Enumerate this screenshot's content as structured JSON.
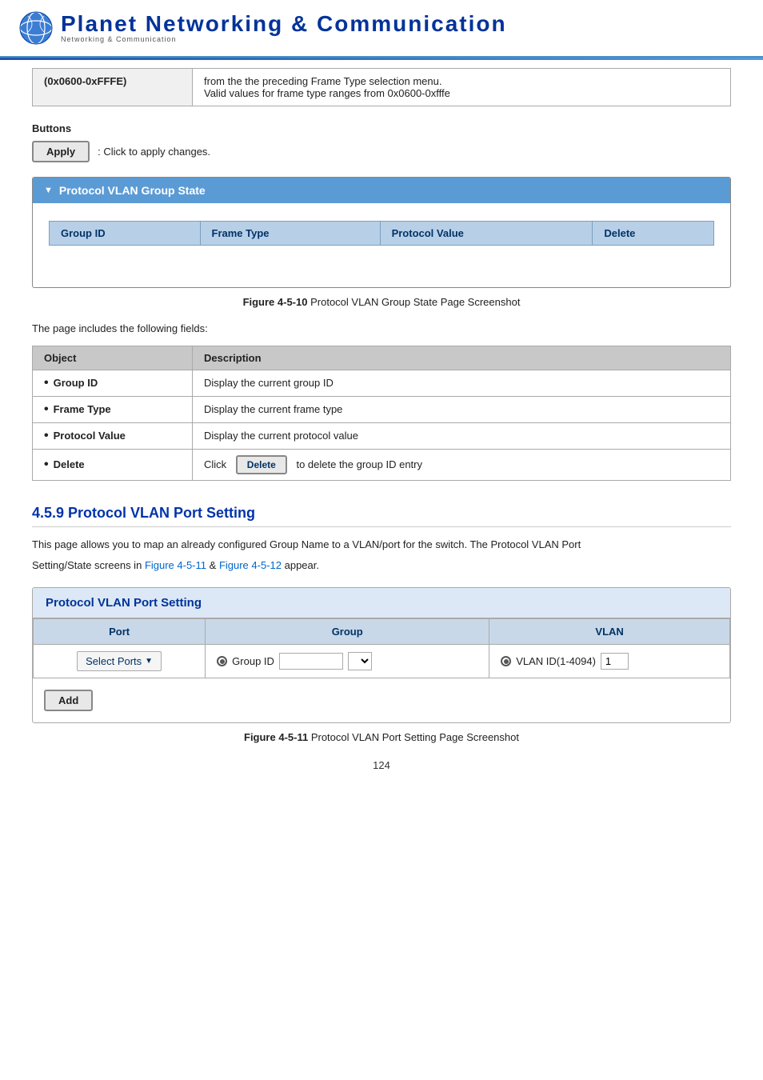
{
  "header": {
    "logo_alt": "Planet Networking & Communication",
    "tagline": "Networking & Communication"
  },
  "info_table": {
    "col1": "(0x0600-0xFFFE)",
    "col2_line1": "from the the preceding Frame Type selection menu.",
    "col2_line2": "Valid values for frame type ranges from 0x0600-0xfffe"
  },
  "buttons_section": {
    "label": "Buttons",
    "apply_btn": "Apply",
    "apply_desc": ": Click to apply changes."
  },
  "vlan_group_state": {
    "title": "Protocol VLAN Group State",
    "columns": [
      "Group ID",
      "Frame Type",
      "Protocol Value",
      "Delete"
    ]
  },
  "figure_410": {
    "label": "Figure 4-5-10",
    "caption": "Protocol VLAN Group State Page Screenshot"
  },
  "fields_intro": "The page includes the following fields:",
  "desc_table": {
    "header_obj": "Object",
    "header_desc": "Description",
    "rows": [
      {
        "object": "Group ID",
        "description": "Display the current group ID"
      },
      {
        "object": "Frame Type",
        "description": "Display the current frame type"
      },
      {
        "object": "Protocol Value",
        "description": "Display the current protocol value"
      },
      {
        "object": "Delete",
        "description_prefix": "Click",
        "delete_btn": "Delete",
        "description_suffix": "to delete the group ID entry"
      }
    ]
  },
  "section_459": {
    "title": "4.5.9 Protocol VLAN Port Setting",
    "intro1": "This page allows you to map an already configured Group Name to a VLAN/port for the switch. The Protocol VLAN Port",
    "intro2": "Setting/State screens in",
    "link1": "Figure 4-5-11",
    "between": " & ",
    "link2": "Figure 4-5-12",
    "intro3": "appear."
  },
  "port_setting": {
    "title": "Protocol VLAN Port Setting",
    "col_port": "Port",
    "col_group": "Group",
    "col_vlan": "VLAN",
    "select_ports_label": "Select Ports",
    "group_id_label": "Group ID",
    "vlan_id_label": "VLAN ID(1-4094)",
    "vlan_id_value": "1",
    "add_btn": "Add"
  },
  "figure_411": {
    "label": "Figure 4-5-11",
    "caption": "Protocol VLAN Port Setting Page Screenshot"
  },
  "page_number": "124"
}
